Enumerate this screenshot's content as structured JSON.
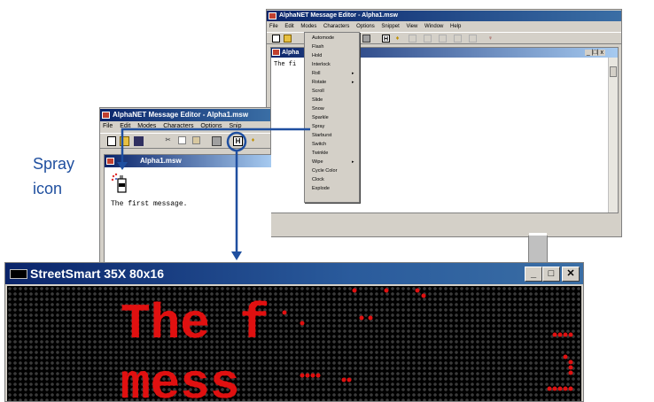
{
  "annotation": {
    "line1": "Spray",
    "line2": "icon"
  },
  "back_window": {
    "title": "AlphaNET Message Editor - Alpha1.msw",
    "menu": [
      "File",
      "Edit",
      "Modes",
      "Characters",
      "Options",
      "Snippet",
      "View",
      "Window",
      "Help"
    ],
    "child_title": "Alpha",
    "child_text": "The fi",
    "child_controls": "_ |□| x",
    "modes_menu": [
      "Automode",
      "Flash",
      "Hold",
      "Interlock",
      "Roll",
      "Rotate",
      "Scroll",
      "Slide",
      "Snow",
      "Sparkle",
      "Spray",
      "Starburst",
      "Switch",
      "Twinkle",
      "Wipe",
      "Cycle Color",
      "Clock",
      "Explode"
    ],
    "submenu_arrow": "▸"
  },
  "front_window": {
    "title": "AlphaNET Message Editor - Alpha1.msw",
    "menu": [
      "File",
      "Edit",
      "Modes",
      "Characters",
      "Options",
      "Snip"
    ],
    "child_title": "Alpha1.msw",
    "child_text": "The first message."
  },
  "led_window": {
    "title": "StreetSmart 35X 80x16",
    "min": "_",
    "max": "□",
    "close": "✕",
    "led_color": "#e01010",
    "line1": "The f",
    "line2": "mess"
  },
  "colors": {
    "callout": "#1f4fa0",
    "title_dark": "#0a246a"
  }
}
